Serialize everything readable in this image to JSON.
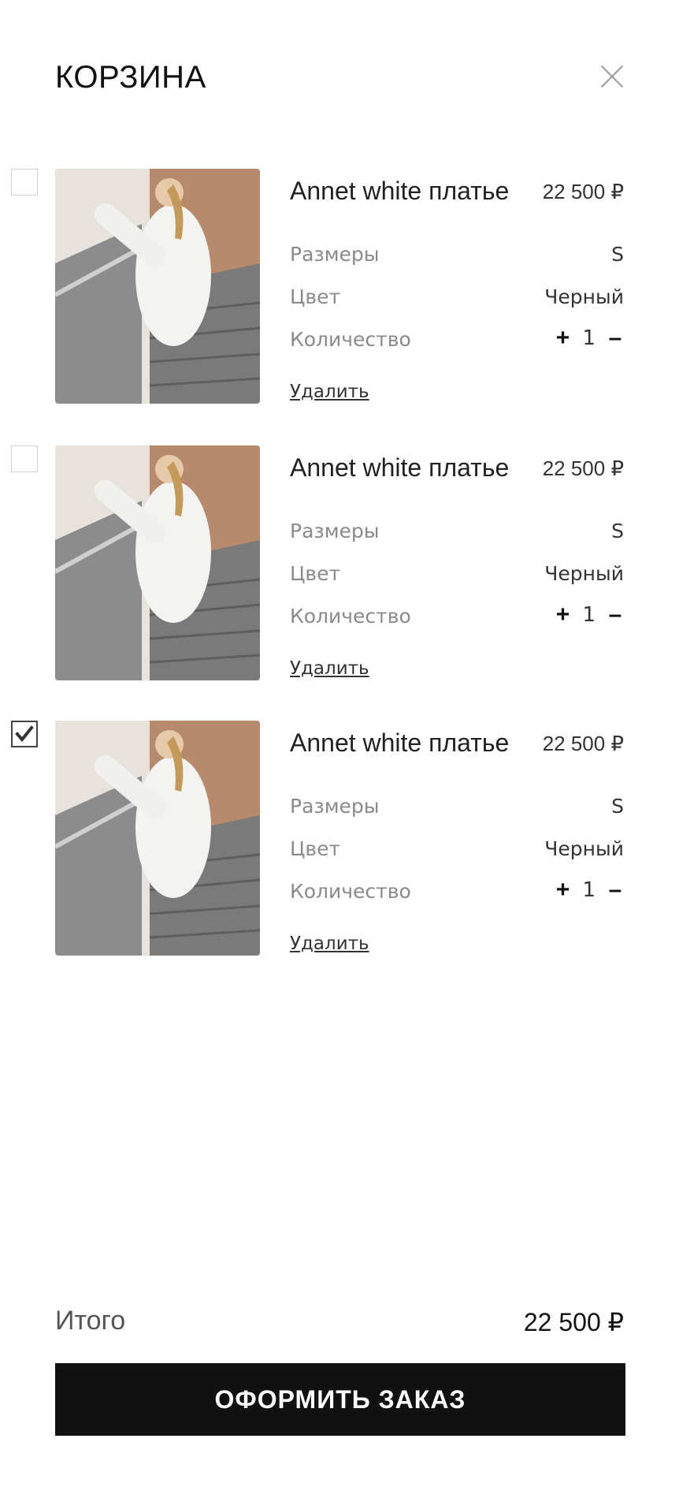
{
  "header": {
    "title": "КОРЗИНА"
  },
  "items": [
    {
      "checked": false,
      "name": "Annet white платье",
      "price": "22 500 ₽",
      "size_label": "Размеры",
      "size": "S",
      "color_label": "Цвет",
      "color": "Черный",
      "qty_label": "Количество",
      "qty": "1",
      "plus": "+",
      "minus": "–",
      "remove": "Удалить"
    },
    {
      "checked": false,
      "name": "Annet white платье",
      "price": "22 500 ₽",
      "size_label": "Размеры",
      "size": "S",
      "color_label": "Цвет",
      "color": "Черный",
      "qty_label": "Количество",
      "qty": "1",
      "plus": "+",
      "minus": "–",
      "remove": "Удалить"
    },
    {
      "checked": true,
      "name": "Annet white платье",
      "price": "22 500 ₽",
      "size_label": "Размеры",
      "size": "S",
      "color_label": "Цвет",
      "color": "Черный",
      "qty_label": "Количество",
      "qty": "1",
      "plus": "+",
      "minus": "–",
      "remove": "Удалить"
    }
  ],
  "summary": {
    "total_label": "Итого",
    "total_value": "22 500 ₽"
  },
  "checkout": {
    "label": "ОФОРМИТЬ ЗАКАЗ"
  },
  "icons": {
    "close": "close-icon",
    "check": "checkmark-icon"
  }
}
